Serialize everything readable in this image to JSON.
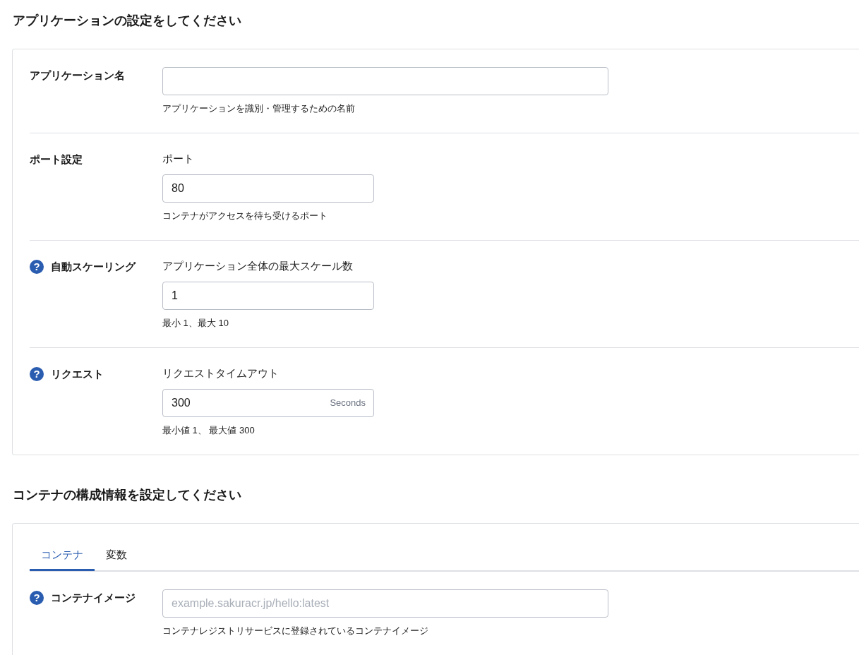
{
  "sections": [
    {
      "heading": "アプリケーションの設定をしてください",
      "rows": [
        {
          "label": "アプリケーション名",
          "input": {
            "kind": "text"
          },
          "hint": "アプリケーションを識別・管理するための名前"
        },
        {
          "label": "ポート設定",
          "sublabel": "ポート",
          "input": {
            "kind": "number",
            "value": "80"
          },
          "hint": "コンテナがアクセスを待ち受けるポート"
        },
        {
          "label": "自動スケーリング",
          "help_icon": "?",
          "sublabel": "アプリケーション全体の最大スケール数",
          "input": {
            "kind": "number",
            "value": "1"
          },
          "hint": "最小 1、最大 10"
        },
        {
          "label": "リクエスト",
          "help_icon": "?",
          "sublabel": "リクエストタイムアウト",
          "input": {
            "kind": "number",
            "value": "300",
            "suffix": "Seconds"
          },
          "hint": "最小値 1、 最大値 300"
        }
      ]
    },
    {
      "heading": "コンテナの構成情報を設定してください",
      "tabs": [
        {
          "label": "コンテナ",
          "selected": true
        },
        {
          "label": "変数",
          "selected": false
        }
      ],
      "rows": [
        {
          "label": "コンテナイメージ",
          "help_icon": "?",
          "input": {
            "kind": "text",
            "placeholder": "example.sakuracr.jp/hello:latest"
          },
          "hint": "コンテナレジストリサービスに登録されているコンテナイメージ"
        }
      ]
    }
  ]
}
